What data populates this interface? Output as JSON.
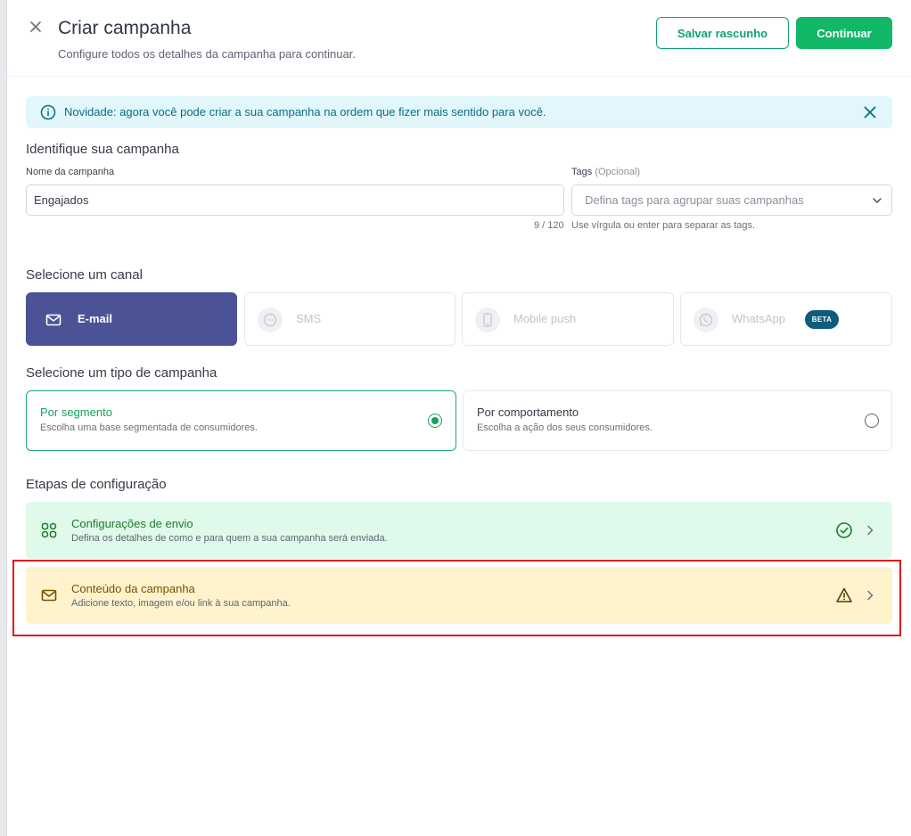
{
  "header": {
    "title": "Criar campanha",
    "subtitle": "Configure todos os detalhes da campanha para continuar.",
    "save_draft_label": "Salvar rascunho",
    "continue_label": "Continuar"
  },
  "notice": {
    "text": "Novidade: agora você pode criar a sua campanha na ordem que fizer mais sentido para você."
  },
  "identify": {
    "section_title": "Identifique sua campanha",
    "name_label": "Nome da campanha",
    "name_value": "Engajados",
    "name_counter": "9 / 120",
    "tags_label": "Tags",
    "tags_optional": "(Opcional)",
    "tags_placeholder": "Defina tags para agrupar suas campanhas",
    "tags_hint": "Use vírgula ou enter para separar as tags."
  },
  "channels": {
    "section_title": "Selecione um canal",
    "items": [
      {
        "label": "E-mail",
        "icon": "mail-icon",
        "selected": true
      },
      {
        "label": "SMS",
        "icon": "chat-bubble-icon",
        "selected": false
      },
      {
        "label": "Mobile push",
        "icon": "smartphone-icon",
        "selected": false
      },
      {
        "label": "WhatsApp",
        "icon": "whatsapp-icon",
        "selected": false,
        "badge": "BETA"
      }
    ]
  },
  "campaign_type": {
    "section_title": "Selecione um tipo de campanha",
    "options": [
      {
        "title": "Por segmento",
        "desc": "Escolha uma base segmentada de consumidores.",
        "selected": true
      },
      {
        "title": "Por comportamento",
        "desc": "Escolha a ação dos seus consumidores.",
        "selected": false
      }
    ]
  },
  "steps": {
    "section_title": "Etapas de configuração",
    "items": [
      {
        "title": "Configurações de envio",
        "desc": "Defina os detalhes de como e para quem a sua campanha será enviada.",
        "status": "complete",
        "icon": "grid-icon"
      },
      {
        "title": "Conteúdo da campanha",
        "desc": "Adicione texto, imagem e/ou link à sua campanha.",
        "status": "warning",
        "icon": "mail-icon"
      }
    ]
  },
  "colors": {
    "primary_green": "#10b868",
    "channel_active": "#4b5396",
    "notice_bg": "#e1f7fb",
    "step_complete_bg": "#dffaea",
    "step_warning_bg": "#fff3cd",
    "highlight": "#e8141a"
  }
}
